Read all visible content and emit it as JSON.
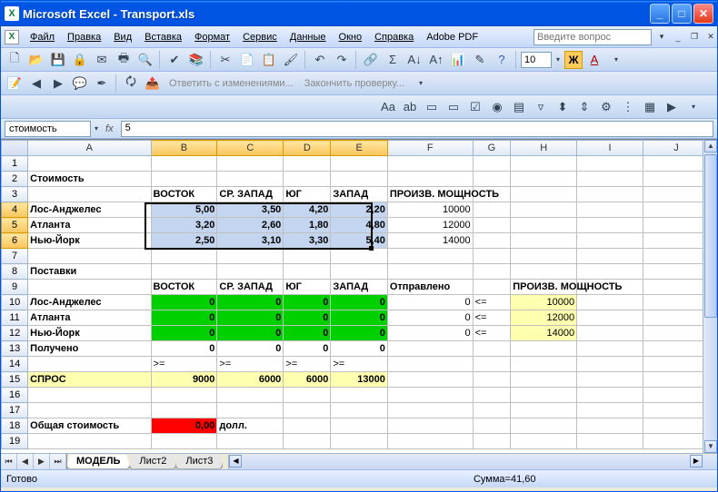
{
  "title": "Microsoft Excel - Transport.xls",
  "menus": [
    "Файл",
    "Правка",
    "Вид",
    "Вставка",
    "Формат",
    "Сервис",
    "Данные",
    "Окно",
    "Справка",
    "Adobe PDF"
  ],
  "askbox_placeholder": "Введите вопрос",
  "toolbar2_text1": "Ответить с изменениями...",
  "toolbar2_text2": "Закончить проверку...",
  "fontsize": "10",
  "bold_label": "Ж",
  "name_box": "стоимость",
  "fx_label": "fx",
  "formula_value": "5",
  "columns": [
    "A",
    "B",
    "C",
    "D",
    "E",
    "F",
    "G",
    "H",
    "I",
    "J"
  ],
  "colsel": [
    "B",
    "C",
    "D",
    "E"
  ],
  "rowsel": [
    4,
    5,
    6
  ],
  "rows": {
    "r2": {
      "A": "Стоимость"
    },
    "r3": {
      "B": "ВОСТОК",
      "C": "СР. ЗАПАД",
      "D": "ЮГ",
      "E": "ЗАПАД",
      "F": "ПРОИЗВ. МОЩНОСТЬ"
    },
    "r4": {
      "A": "Лос-Анджелес",
      "B": "5,00",
      "C": "3,50",
      "D": "4,20",
      "E": "2,20",
      "F": "10000"
    },
    "r5": {
      "A": "Атланта",
      "B": "3,20",
      "C": "2,60",
      "D": "1,80",
      "E": "4,80",
      "F": "12000"
    },
    "r6": {
      "A": "Нью-Йорк",
      "B": "2,50",
      "C": "3,10",
      "D": "3,30",
      "E": "5,40",
      "F": "14000"
    },
    "r8": {
      "A": "Поставки"
    },
    "r9": {
      "B": "ВОСТОК",
      "C": "СР. ЗАПАД",
      "D": "ЮГ",
      "E": "ЗАПАД",
      "F": "Отправлено",
      "H": "ПРОИЗВ. МОЩНОСТЬ"
    },
    "r10": {
      "A": "Лос-Анджелес",
      "B": "0",
      "C": "0",
      "D": "0",
      "E": "0",
      "F": "0",
      "G": "<=",
      "H": "10000"
    },
    "r11": {
      "A": "Атланта",
      "B": "0",
      "C": "0",
      "D": "0",
      "E": "0",
      "F": "0",
      "G": "<=",
      "H": "12000"
    },
    "r12": {
      "A": "Нью-Йорк",
      "B": "0",
      "C": "0",
      "D": "0",
      "E": "0",
      "F": "0",
      "G": "<=",
      "H": "14000"
    },
    "r13": {
      "A": "Получено",
      "B": "0",
      "C": "0",
      "D": "0",
      "E": "0"
    },
    "r14": {
      "B": ">=",
      "C": ">=",
      "D": ">=",
      "E": ">="
    },
    "r15": {
      "A": "СПРОС",
      "B": "9000",
      "C": "6000",
      "D": "6000",
      "E": "13000"
    },
    "r18": {
      "A": "Общая стоимость",
      "B": "0,00",
      "C": "долл."
    }
  },
  "tabs": [
    "МОДЕЛЬ",
    "Лист2",
    "Лист3"
  ],
  "active_tab": 0,
  "status_ready": "Готово",
  "status_sum": "Сумма=41,60",
  "chart_data": {
    "type": "table",
    "title": "Транспортная задача",
    "cost_matrix": {
      "rows": [
        "Лос-Анджелес",
        "Атланта",
        "Нью-Йорк"
      ],
      "cols": [
        "ВОСТОК",
        "СР. ЗАПАД",
        "ЮГ",
        "ЗАПАД"
      ],
      "values": [
        [
          5.0,
          3.5,
          4.2,
          2.2
        ],
        [
          3.2,
          2.6,
          1.8,
          4.8
        ],
        [
          2.5,
          3.1,
          3.3,
          5.4
        ]
      ],
      "capacity": [
        10000,
        12000,
        14000
      ]
    },
    "shipments": {
      "rows": [
        "Лос-Анджелес",
        "Атланта",
        "Нью-Йорк"
      ],
      "cols": [
        "ВОСТОК",
        "СР. ЗАПАД",
        "ЮГ",
        "ЗАПАД"
      ],
      "values": [
        [
          0,
          0,
          0,
          0
        ],
        [
          0,
          0,
          0,
          0
        ],
        [
          0,
          0,
          0,
          0
        ]
      ],
      "sent": [
        0,
        0,
        0
      ],
      "sent_constraint": "<=",
      "capacity": [
        10000,
        12000,
        14000
      ],
      "received": [
        0,
        0,
        0,
        0
      ],
      "received_constraint": ">=",
      "demand": [
        9000,
        6000,
        6000,
        13000
      ]
    },
    "total_cost": 0.0,
    "total_cost_unit": "долл.",
    "selection_sum": 41.6
  }
}
